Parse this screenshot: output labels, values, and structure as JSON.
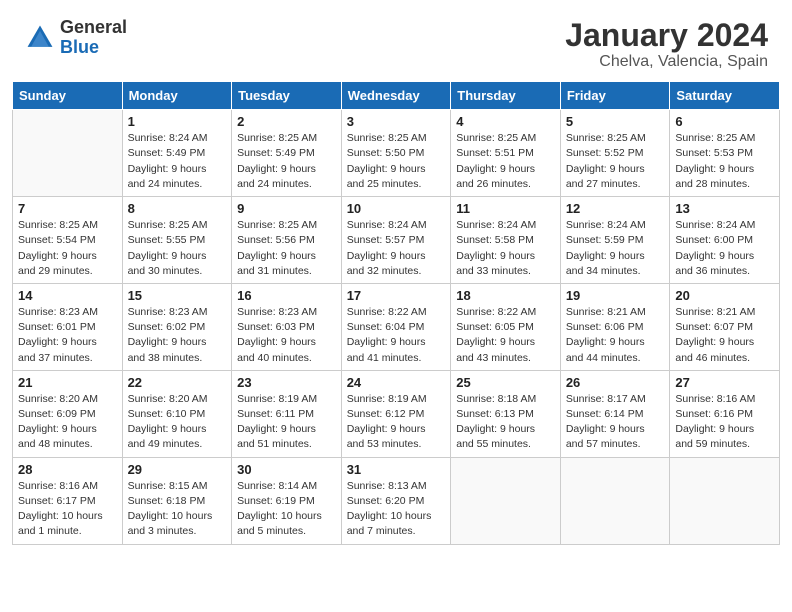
{
  "logo": {
    "general": "General",
    "blue": "Blue"
  },
  "title": "January 2024",
  "location": "Chelva, Valencia, Spain",
  "weekdays": [
    "Sunday",
    "Monday",
    "Tuesday",
    "Wednesday",
    "Thursday",
    "Friday",
    "Saturday"
  ],
  "weeks": [
    [
      {
        "day": null,
        "info": null
      },
      {
        "day": "1",
        "info": "Sunrise: 8:24 AM\nSunset: 5:49 PM\nDaylight: 9 hours\nand 24 minutes."
      },
      {
        "day": "2",
        "info": "Sunrise: 8:25 AM\nSunset: 5:49 PM\nDaylight: 9 hours\nand 24 minutes."
      },
      {
        "day": "3",
        "info": "Sunrise: 8:25 AM\nSunset: 5:50 PM\nDaylight: 9 hours\nand 25 minutes."
      },
      {
        "day": "4",
        "info": "Sunrise: 8:25 AM\nSunset: 5:51 PM\nDaylight: 9 hours\nand 26 minutes."
      },
      {
        "day": "5",
        "info": "Sunrise: 8:25 AM\nSunset: 5:52 PM\nDaylight: 9 hours\nand 27 minutes."
      },
      {
        "day": "6",
        "info": "Sunrise: 8:25 AM\nSunset: 5:53 PM\nDaylight: 9 hours\nand 28 minutes."
      }
    ],
    [
      {
        "day": "7",
        "info": "Sunrise: 8:25 AM\nSunset: 5:54 PM\nDaylight: 9 hours\nand 29 minutes."
      },
      {
        "day": "8",
        "info": "Sunrise: 8:25 AM\nSunset: 5:55 PM\nDaylight: 9 hours\nand 30 minutes."
      },
      {
        "day": "9",
        "info": "Sunrise: 8:25 AM\nSunset: 5:56 PM\nDaylight: 9 hours\nand 31 minutes."
      },
      {
        "day": "10",
        "info": "Sunrise: 8:24 AM\nSunset: 5:57 PM\nDaylight: 9 hours\nand 32 minutes."
      },
      {
        "day": "11",
        "info": "Sunrise: 8:24 AM\nSunset: 5:58 PM\nDaylight: 9 hours\nand 33 minutes."
      },
      {
        "day": "12",
        "info": "Sunrise: 8:24 AM\nSunset: 5:59 PM\nDaylight: 9 hours\nand 34 minutes."
      },
      {
        "day": "13",
        "info": "Sunrise: 8:24 AM\nSunset: 6:00 PM\nDaylight: 9 hours\nand 36 minutes."
      }
    ],
    [
      {
        "day": "14",
        "info": "Sunrise: 8:23 AM\nSunset: 6:01 PM\nDaylight: 9 hours\nand 37 minutes."
      },
      {
        "day": "15",
        "info": "Sunrise: 8:23 AM\nSunset: 6:02 PM\nDaylight: 9 hours\nand 38 minutes."
      },
      {
        "day": "16",
        "info": "Sunrise: 8:23 AM\nSunset: 6:03 PM\nDaylight: 9 hours\nand 40 minutes."
      },
      {
        "day": "17",
        "info": "Sunrise: 8:22 AM\nSunset: 6:04 PM\nDaylight: 9 hours\nand 41 minutes."
      },
      {
        "day": "18",
        "info": "Sunrise: 8:22 AM\nSunset: 6:05 PM\nDaylight: 9 hours\nand 43 minutes."
      },
      {
        "day": "19",
        "info": "Sunrise: 8:21 AM\nSunset: 6:06 PM\nDaylight: 9 hours\nand 44 minutes."
      },
      {
        "day": "20",
        "info": "Sunrise: 8:21 AM\nSunset: 6:07 PM\nDaylight: 9 hours\nand 46 minutes."
      }
    ],
    [
      {
        "day": "21",
        "info": "Sunrise: 8:20 AM\nSunset: 6:09 PM\nDaylight: 9 hours\nand 48 minutes."
      },
      {
        "day": "22",
        "info": "Sunrise: 8:20 AM\nSunset: 6:10 PM\nDaylight: 9 hours\nand 49 minutes."
      },
      {
        "day": "23",
        "info": "Sunrise: 8:19 AM\nSunset: 6:11 PM\nDaylight: 9 hours\nand 51 minutes."
      },
      {
        "day": "24",
        "info": "Sunrise: 8:19 AM\nSunset: 6:12 PM\nDaylight: 9 hours\nand 53 minutes."
      },
      {
        "day": "25",
        "info": "Sunrise: 8:18 AM\nSunset: 6:13 PM\nDaylight: 9 hours\nand 55 minutes."
      },
      {
        "day": "26",
        "info": "Sunrise: 8:17 AM\nSunset: 6:14 PM\nDaylight: 9 hours\nand 57 minutes."
      },
      {
        "day": "27",
        "info": "Sunrise: 8:16 AM\nSunset: 6:16 PM\nDaylight: 9 hours\nand 59 minutes."
      }
    ],
    [
      {
        "day": "28",
        "info": "Sunrise: 8:16 AM\nSunset: 6:17 PM\nDaylight: 10 hours\nand 1 minute."
      },
      {
        "day": "29",
        "info": "Sunrise: 8:15 AM\nSunset: 6:18 PM\nDaylight: 10 hours\nand 3 minutes."
      },
      {
        "day": "30",
        "info": "Sunrise: 8:14 AM\nSunset: 6:19 PM\nDaylight: 10 hours\nand 5 minutes."
      },
      {
        "day": "31",
        "info": "Sunrise: 8:13 AM\nSunset: 6:20 PM\nDaylight: 10 hours\nand 7 minutes."
      },
      {
        "day": null,
        "info": null
      },
      {
        "day": null,
        "info": null
      },
      {
        "day": null,
        "info": null
      }
    ]
  ]
}
